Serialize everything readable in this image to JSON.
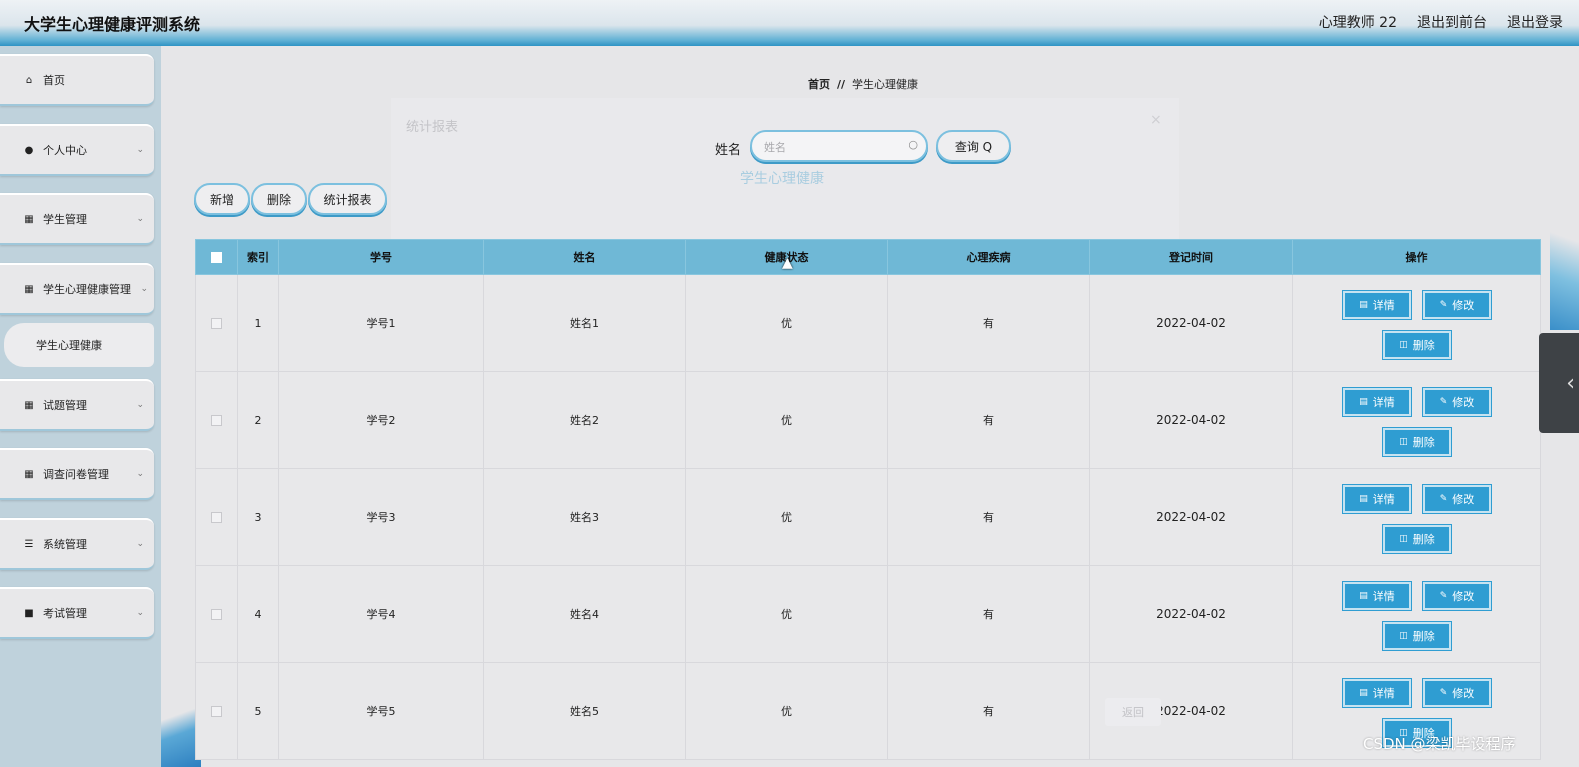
{
  "header": {
    "title": "大学生心理健康评测系统",
    "user": "心理教师 22",
    "to_front": "退出到前台",
    "logout": "退出登录"
  },
  "sidebar": {
    "items": [
      {
        "label": "首页",
        "icon": "home-icon"
      },
      {
        "label": "个人中心",
        "icon": "user-icon"
      },
      {
        "label": "学生管理",
        "icon": "grid-icon"
      },
      {
        "label": "学生心理健康管理",
        "icon": "grid-icon"
      },
      {
        "label": "试题管理",
        "icon": "grid-icon"
      },
      {
        "label": "调查问卷管理",
        "icon": "grid-icon"
      },
      {
        "label": "系统管理",
        "icon": "list-icon"
      },
      {
        "label": "考试管理",
        "icon": "book-icon"
      }
    ],
    "sub_item": "学生心理健康"
  },
  "breadcrumb": {
    "home": "首页",
    "separator": "//",
    "current": "学生心理健康"
  },
  "ghost": {
    "title": "统计报表",
    "subtitle": "学生心理健康",
    "close": "×",
    "back": "返回"
  },
  "search": {
    "label": "姓名",
    "placeholder": "姓名",
    "query_button": "查询 Q"
  },
  "toolbar": {
    "add": "新增",
    "delete": "删除",
    "report": "统计报表"
  },
  "table": {
    "headers": [
      "索引",
      "学号",
      "姓名",
      "健康状态",
      "心理疾病",
      "登记时间",
      "操作"
    ],
    "rows": [
      {
        "index": "1",
        "student_no": "学号1",
        "name": "姓名1",
        "health": "优",
        "disease": "有",
        "date": "2022-04-02"
      },
      {
        "index": "2",
        "student_no": "学号2",
        "name": "姓名2",
        "health": "优",
        "disease": "有",
        "date": "2022-04-02"
      },
      {
        "index": "3",
        "student_no": "学号3",
        "name": "姓名3",
        "health": "优",
        "disease": "有",
        "date": "2022-04-02"
      },
      {
        "index": "4",
        "student_no": "学号4",
        "name": "姓名4",
        "health": "优",
        "disease": "有",
        "date": "2022-04-02"
      },
      {
        "index": "5",
        "student_no": "学号5",
        "name": "姓名5",
        "health": "优",
        "disease": "有",
        "date": "2022-04-02"
      }
    ],
    "actions": {
      "detail": "详情",
      "edit": "修改",
      "delete": "删除"
    }
  },
  "watermark": "CSDN @梁凯毕设程序",
  "colors": {
    "accent": "#2f9dd2",
    "table_header": "#6fb8d6",
    "sidebar_bg": "#bfd2dc"
  }
}
